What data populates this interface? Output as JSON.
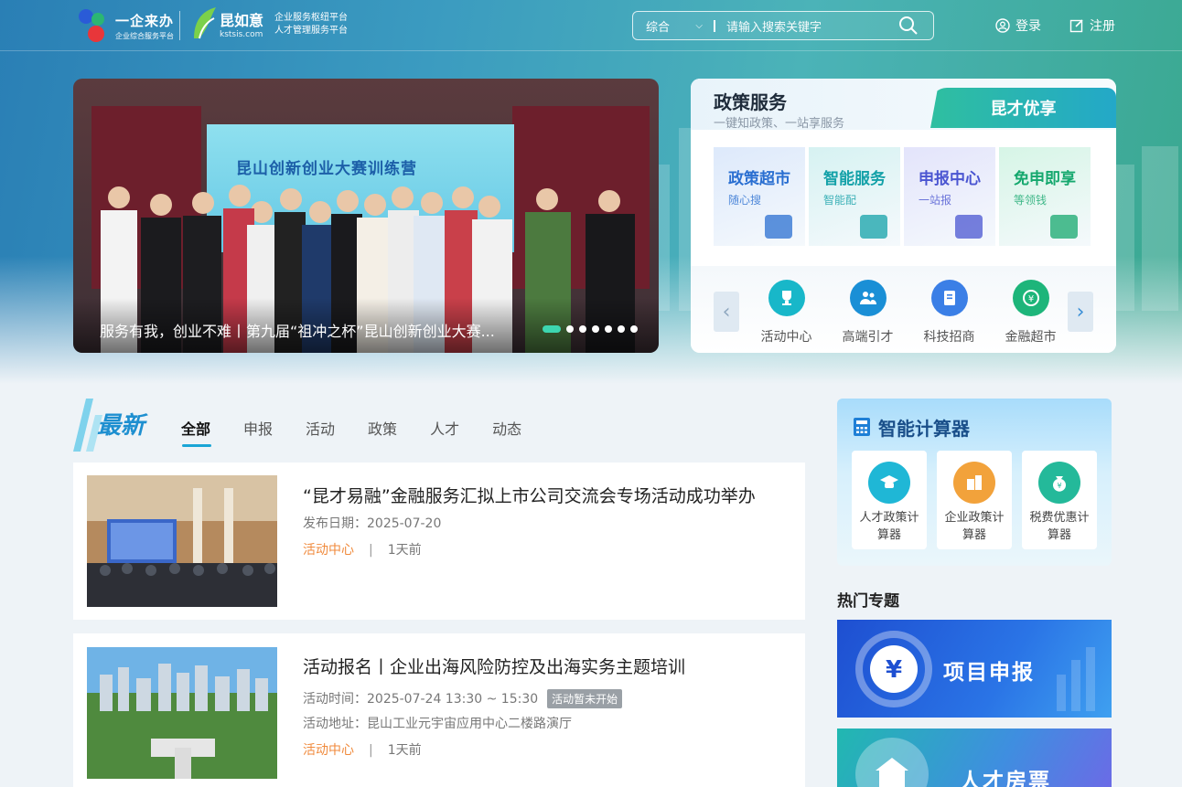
{
  "header": {
    "logo1_title": "一企来办",
    "logo1_sub": "企业综合服务平台",
    "logo2_title": "昆如意",
    "logo2_domain": "kstsis.com",
    "logo2_line1": "企业服务枢纽平台",
    "logo2_line2": "人才管理服务平台",
    "search_category": "综合",
    "search_placeholder": "请输入搜索关键字",
    "login": "登录",
    "register": "注册"
  },
  "banner": {
    "stage_title": "昆山创新创业大赛训练营",
    "caption": "服务有我，创业不难丨第九届“祖冲之杯”昆山创新创业大赛...",
    "slides_count": 7,
    "active_slide": 1
  },
  "policy": {
    "title": "政策服务",
    "subtitle": "一键知政策、一站享服务",
    "tab": "昆才优享",
    "tiles": [
      {
        "title": "政策超市",
        "sub": "随心搜",
        "color": "#2a6fd1",
        "bg": "#dde9fb"
      },
      {
        "title": "智能服务",
        "sub": "智能配",
        "color": "#13a1a8",
        "bg": "#d6f2f2"
      },
      {
        "title": "申报中心",
        "sub": "一站报",
        "color": "#4a55d1",
        "bg": "#e3e4fb"
      },
      {
        "title": "免申即享",
        "sub": "等领钱",
        "color": "#15a86e",
        "bg": "#d6f5e6"
      }
    ],
    "quick": [
      {
        "label": "活动中心",
        "icon": "trophy-icon",
        "color": "#18b7c9"
      },
      {
        "label": "高端引才",
        "icon": "people-icon",
        "color": "#1a8fd6"
      },
      {
        "label": "科技招商",
        "icon": "document-icon",
        "color": "#3b7fe6"
      },
      {
        "label": "金融超市",
        "icon": "coin-icon",
        "color": "#1db57a"
      }
    ]
  },
  "news": {
    "heading": "最新",
    "tabs": [
      "全部",
      "申报",
      "活动",
      "政策",
      "人才",
      "动态"
    ],
    "active_tab": "全部",
    "items": [
      {
        "title": "“昆才易融”金融服务汇拟上市公司交流会专场活动成功举办",
        "date_label": "发布日期：",
        "date": "2025-07-20",
        "category": "活动中心",
        "ago": "1天前"
      },
      {
        "title": "活动报名丨企业出海风险防控及出海实务主题培训",
        "time_label": "活动时间：",
        "time": "2025-07-24 13:30 ~ 15:30",
        "status": "活动暂未开始",
        "place_label": "活动地址：",
        "place": "昆山工业元宇宙应用中心二楼路演厅",
        "category": "活动中心",
        "ago": "1天前"
      }
    ]
  },
  "calculator": {
    "title": "智能计算器",
    "items": [
      {
        "line1": "人才政策计",
        "line2": "算器",
        "color": "#1fb7d6"
      },
      {
        "line1": "企业政策计",
        "line2": "算器",
        "color": "#f2a23b"
      },
      {
        "line1": "税费优惠计",
        "line2": "算器",
        "color": "#24b99a"
      }
    ]
  },
  "hot": {
    "title": "热门专题",
    "items": [
      "项目申报",
      "人才房票"
    ]
  },
  "colors": {
    "accent": "#1aa5d6",
    "orange": "#f08a3c"
  }
}
